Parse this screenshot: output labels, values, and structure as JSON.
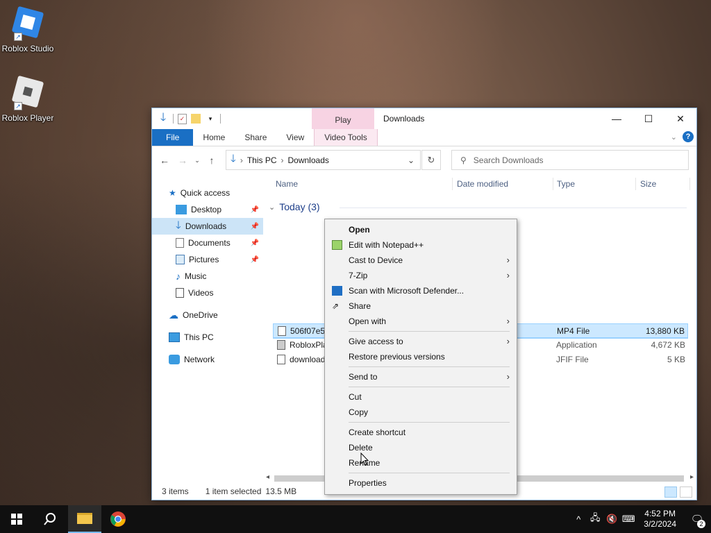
{
  "desktop": {
    "icons": [
      {
        "label": "Roblox Studio",
        "icon": "roblox-studio-icon"
      },
      {
        "label": "Roblox Player",
        "icon": "roblox-player-icon"
      }
    ]
  },
  "window": {
    "title": "Downloads",
    "contextual_tab_header": "Play",
    "ribbon_tabs": [
      "File",
      "Home",
      "Share",
      "View",
      "Video Tools"
    ],
    "breadcrumb": [
      "This PC",
      "Downloads"
    ],
    "search_placeholder": "Search Downloads",
    "nav": {
      "quick_access": "Quick access",
      "items": [
        "Desktop",
        "Downloads",
        "Documents",
        "Pictures",
        "Music",
        "Videos"
      ],
      "onedrive": "OneDrive",
      "this_pc": "This PC",
      "network": "Network"
    },
    "columns": {
      "name": "Name",
      "date": "Date modified",
      "type": "Type",
      "size": "Size"
    },
    "group": "Today (3)",
    "files": [
      {
        "name": "506f07e5e",
        "type": "MP4 File",
        "size": "13,880 KB"
      },
      {
        "name": "RobloxPla",
        "type": "Application",
        "size": "4,672 KB"
      },
      {
        "name": "download",
        "type": "JFIF File",
        "size": "5 KB"
      }
    ],
    "status": {
      "items": "3 items",
      "selected": "1 item selected",
      "size": "13.5 MB"
    }
  },
  "context_menu": {
    "open": "Open",
    "edit_notepad": "Edit with Notepad++",
    "cast": "Cast to Device",
    "zip": "7-Zip",
    "defender": "Scan with Microsoft Defender...",
    "share": "Share",
    "open_with": "Open with",
    "give_access": "Give access to",
    "restore": "Restore previous versions",
    "send_to": "Send to",
    "cut": "Cut",
    "copy": "Copy",
    "create_shortcut": "Create shortcut",
    "delete": "Delete",
    "rename": "Rename",
    "properties": "Properties"
  },
  "taskbar": {
    "time": "4:52 PM",
    "date": "3/2/2024",
    "notifications": "2"
  },
  "colors": {
    "accent": "#1a6fc4",
    "selection": "#cce8ff",
    "taskbar": "#101010"
  }
}
